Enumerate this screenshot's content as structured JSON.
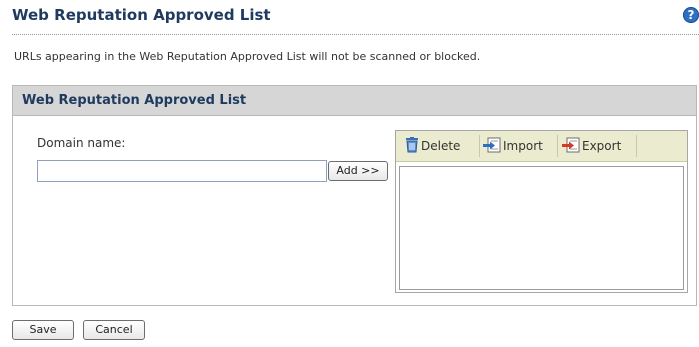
{
  "page": {
    "title": "Web Reputation Approved List",
    "help_icon": "question-mark-icon",
    "description": "URLs appearing in the Web Reputation Approved List will not be scanned or blocked."
  },
  "panel": {
    "header": "Web Reputation Approved List",
    "domain_label": "Domain name:",
    "domain_value": "",
    "add_button": "Add >>"
  },
  "list_toolbar": {
    "delete_label": "Delete",
    "delete_icon": "trash-icon",
    "import_label": "Import",
    "import_icon": "import-icon",
    "export_label": "Export",
    "export_icon": "export-icon"
  },
  "approved_list": [],
  "footer": {
    "save_button": "Save",
    "cancel_button": "Cancel"
  },
  "colors": {
    "title": "#1f3a5f",
    "panel_header_bg": "#d6d6d6",
    "toolbar_bg": "#ebebcf",
    "help_icon": "#2f6fc0"
  }
}
